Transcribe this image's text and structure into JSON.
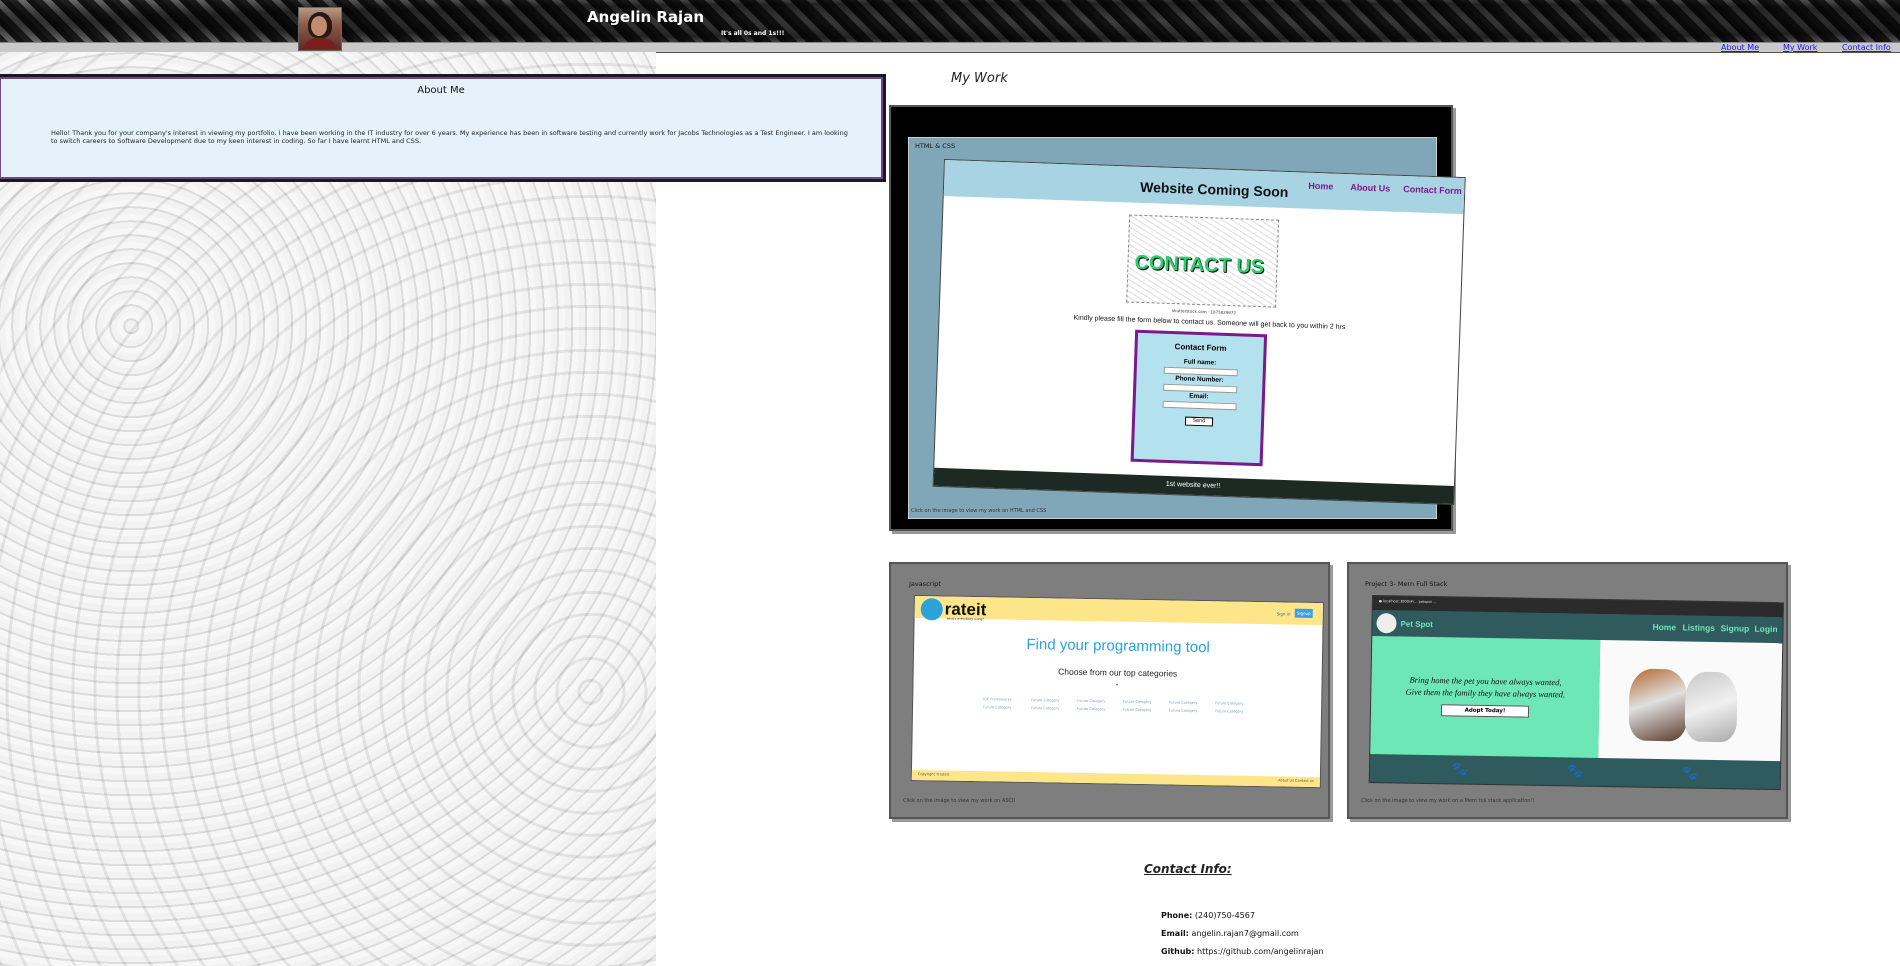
{
  "header": {
    "title": "Angelin Rajan",
    "tagline": "It's all 0s and 1s!!!",
    "avatar": "profile-photo"
  },
  "nav": {
    "links": [
      "About Me",
      "My Work",
      "Contact Info"
    ]
  },
  "about": {
    "title": "About Me",
    "text": "Hello! Thank you for your company's interest in viewing my portfolio. I have been working in the IT industry for over 6 years. My experience has been in software testing and currently work for Jacobs Technologies as a Test Engineer. I am looking to switch careers to Software Development due to my keen interest in coding. So far I have learnt HTML and CSS."
  },
  "work": {
    "title": "My Work",
    "projects": [
      {
        "label": "HTML & CSS",
        "caption": "Click on the image to view my work on HTML and CSS",
        "preview": {
          "heading": "Website Coming Soon",
          "nav": [
            "Home",
            "About Us",
            "Contact Form"
          ],
          "contact_art": "CONTACT US",
          "credit": "shutterstock.com · 1875829972",
          "kindly": "Kindly please fill the form below to contact us. Someone will get back to you within 2 hrs",
          "form_title": "Contact Form",
          "fields": [
            "Full name:",
            "Phone Number:",
            "Email:"
          ],
          "send": "Send",
          "footer": "1st website ever!!"
        }
      },
      {
        "label": "Javascript",
        "caption": "Click on the image to view my work on ASCII",
        "preview": {
          "logo": "rateit",
          "slogan": "what's everybody using?",
          "signin": "Sign in",
          "signup": "Signup",
          "heading": "Find your programming tool",
          "sub": "Choose from our top categories",
          "first_category": "IDE Frameworks",
          "category": "Future Category",
          "copyright": "Copyright ®rateit",
          "footer_links": "About Us     Contact us"
        }
      },
      {
        "label": "Project 3- Mern Full Stack",
        "caption": "Click on the image to view my work on a Mern full stack application!!",
        "preview": {
          "url": "● localhost:3000/#/... petspot ...",
          "brand": "Pet Spot",
          "nav": [
            "Home",
            "Listings",
            "Signup",
            "Login"
          ],
          "line1": "Bring home the pet you have always wanted,",
          "line2": "Give them the family they have always wanted.",
          "button": "Adopt Today!"
        }
      }
    ]
  },
  "contact": {
    "title": "Contact Info:",
    "phone_label": "Phone:",
    "phone": "(240)750-4567",
    "email_label": "Email:",
    "email": "angelin.rajan7@gmail.com",
    "github_label": "Github:",
    "github": "https://github.com/angelinrajan"
  },
  "colors": {
    "about_bg": "#e5f1fb",
    "link": "#1a1aff",
    "card_bg": "#7e7e7e",
    "mint": "#6ee7b7",
    "purple": "#7b1a8a"
  }
}
